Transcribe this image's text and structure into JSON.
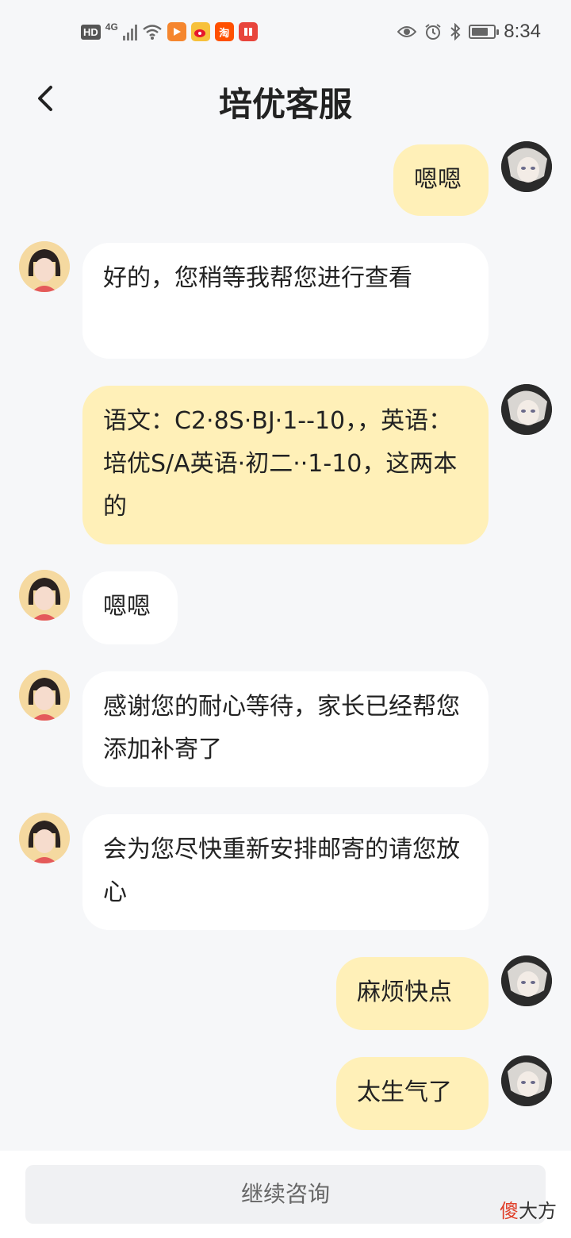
{
  "status_bar": {
    "hd": "HD",
    "network": "4G",
    "time": "8:34",
    "battery_level": 0.75,
    "icons": [
      "signal-icon",
      "wifi-icon",
      "video-app-icon",
      "weibo-app-icon",
      "taobao-app-icon",
      "reader-app-icon",
      "eye-icon",
      "alarm-icon",
      "bluetooth-icon",
      "battery-icon"
    ],
    "app_labels": {
      "taobao": "淘"
    }
  },
  "header": {
    "title": "培优客服",
    "back_icon": "chevron-left-icon"
  },
  "messages": [
    {
      "side": "me",
      "text": "嗯嗯"
    },
    {
      "side": "them",
      "text": "好的，您稍等我帮您进行查看"
    },
    {
      "side": "me",
      "text": "语文：C2·8S·BJ·1--10，，英语：培优S/A英语·初二··1-10，这两本的"
    },
    {
      "side": "them",
      "text": "嗯嗯"
    },
    {
      "side": "them",
      "text": "感谢您的耐心等待，家长已经帮您添加补寄了"
    },
    {
      "side": "them",
      "text": "会为您尽快重新安排邮寄的请您放心"
    },
    {
      "side": "me",
      "text": "麻烦快点"
    },
    {
      "side": "me",
      "text": "太生气了"
    }
  ],
  "bottom": {
    "continue_label": "继续咨询"
  },
  "watermark": {
    "char1": "傻",
    "rest": "大方"
  },
  "colors": {
    "background": "#f6f7f9",
    "my_bubble": "#fff0b8",
    "their_bubble": "#ffffff"
  }
}
